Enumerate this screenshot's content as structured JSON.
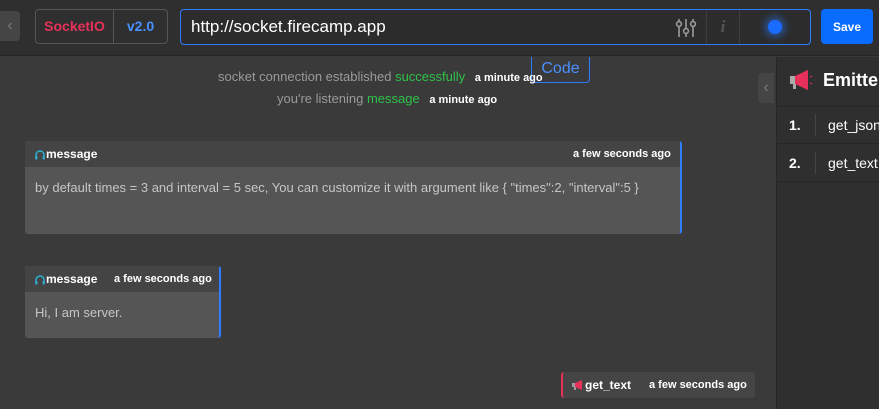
{
  "header": {
    "protocol_name": "SocketIO",
    "version": "v2.0",
    "url": "http://socket.firecamp.app",
    "save_label": "Save",
    "info_glyph": "i"
  },
  "colors": {
    "accent": "#2f7dff",
    "brand": "#e8315a",
    "success": "#2ec24a",
    "save": "#0a6cff"
  },
  "log": {
    "code_label": "Code",
    "connection": {
      "prefix": "socket connection established",
      "status": "successfully",
      "time": "a minute ago"
    },
    "listening": {
      "prefix": "you're listening",
      "event": "message",
      "time": "a minute ago"
    },
    "messages": [
      {
        "event": "message",
        "time": "a few seconds ago",
        "body": "by default times = 3 and interval = 5 sec, You can customize it with argument like { \"times\":2, \"interval\":5 }"
      },
      {
        "event": "message",
        "time": "a few seconds ago",
        "body": "Hi, I am server."
      }
    ],
    "emitted": {
      "event": "get_text",
      "time": "a few seconds ago"
    }
  },
  "emitter_panel": {
    "title": "Emitter",
    "items": [
      {
        "num": "1.",
        "name": "get_json"
      },
      {
        "num": "2.",
        "name": "get_text"
      }
    ]
  },
  "icons": {
    "nav_left": "chevron-left-icon",
    "nav_right": "chevron-left-icon",
    "settings": "sliders-icon",
    "info": "info-icon",
    "connection": "connection-dot-icon",
    "listener": "headphones-icon",
    "emit": "megaphone-icon"
  }
}
